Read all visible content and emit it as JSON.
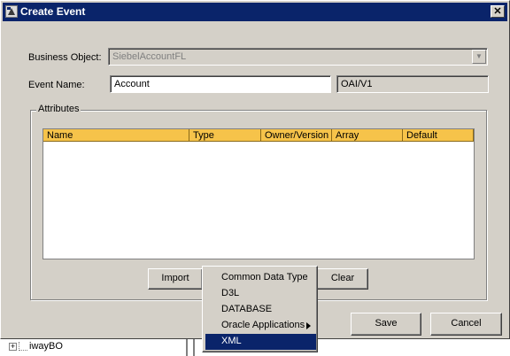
{
  "window": {
    "title": "Create Event",
    "close_symbol": "✕"
  },
  "form": {
    "business_object_label": "Business Object:",
    "business_object_value": "SiebelAccountFL",
    "event_name_label": "Event Name:",
    "event_name_value": "Account",
    "version_value": "OAI/V1"
  },
  "attributes": {
    "group_label": "Attributes",
    "columns": [
      "Name",
      "Type",
      "Owner/Version",
      "Array",
      "Default"
    ]
  },
  "buttons": {
    "import": "Import",
    "clear": "Clear",
    "save": "Save",
    "cancel": "Cancel"
  },
  "import_menu": {
    "items": [
      "Common Data Type",
      "D3L",
      "DATABASE",
      "Oracle Applications",
      "XML"
    ],
    "selected": "XML"
  },
  "tree": {
    "node_label": "iwayBO"
  },
  "colors": {
    "title_bar": "#0a246a",
    "table_header": "#f6c34a",
    "menu_selection": "#0a246a"
  }
}
